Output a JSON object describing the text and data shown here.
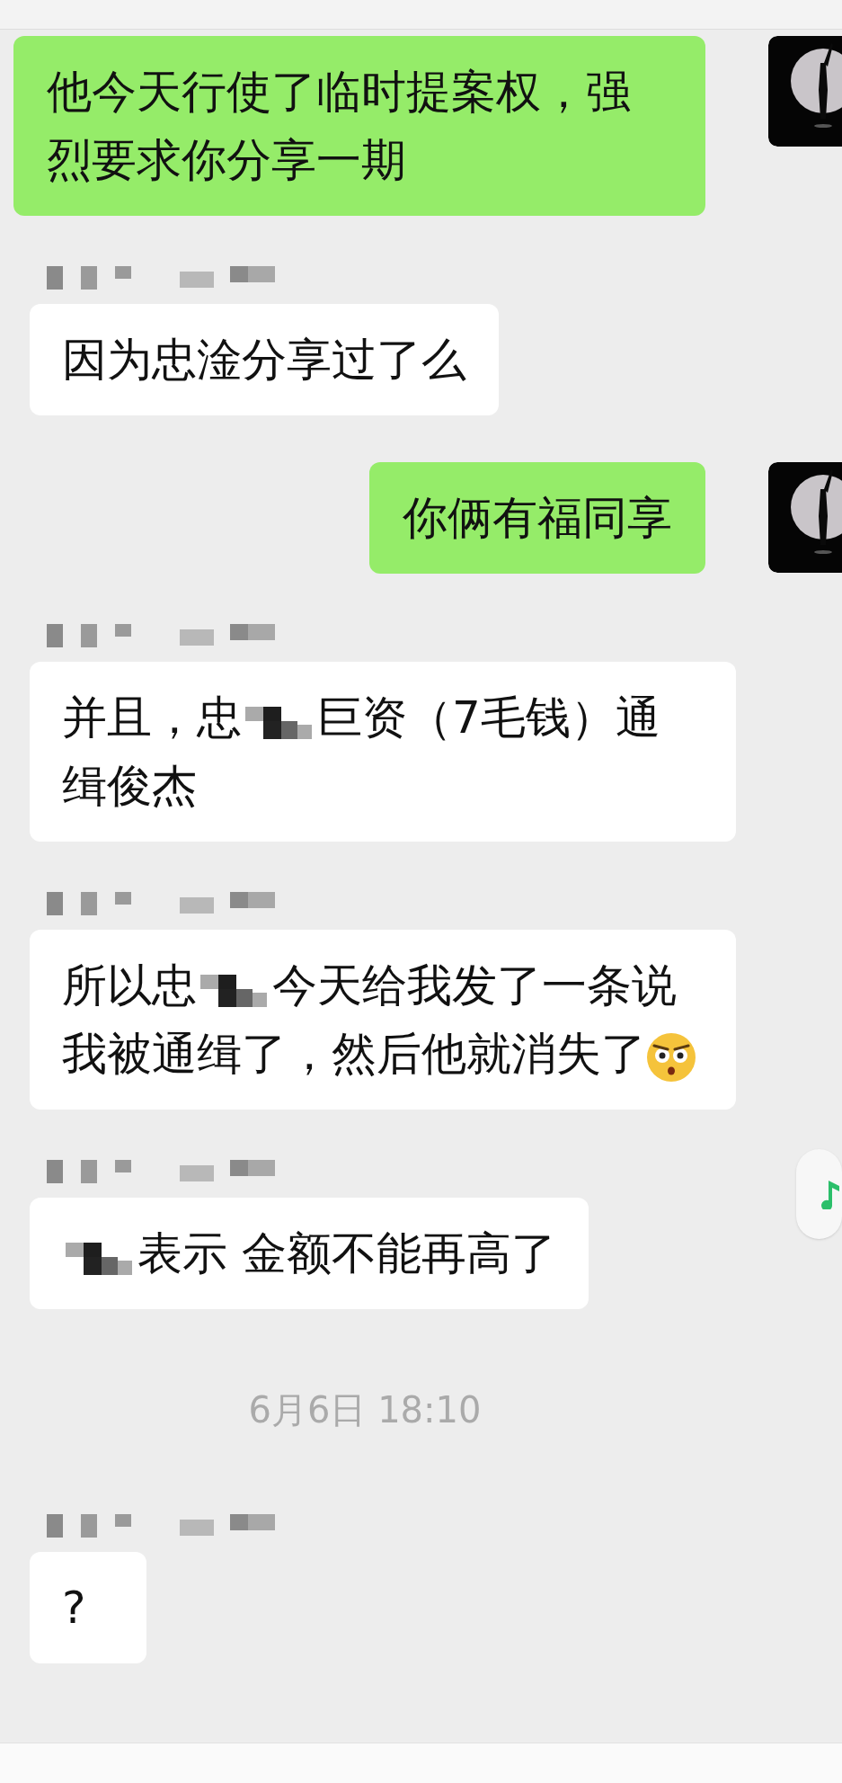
{
  "messages": [
    {
      "kind": "outgoing",
      "segments": [
        {
          "kind": "text",
          "text": "他今天行使了临时提案权，强烈要求你分享一期"
        }
      ]
    },
    {
      "kind": "incoming",
      "segments": [
        {
          "kind": "text",
          "text": "因为忠淦分享过了么"
        }
      ]
    },
    {
      "kind": "outgoing",
      "segments": [
        {
          "kind": "text",
          "text": "你俩有福同享"
        }
      ]
    },
    {
      "kind": "incoming",
      "segments": [
        {
          "kind": "text",
          "text": "并且，忠"
        },
        {
          "kind": "mosaic"
        },
        {
          "kind": "text",
          "text": "巨资（7毛钱）通缉俊杰"
        }
      ]
    },
    {
      "kind": "incoming",
      "segments": [
        {
          "kind": "text",
          "text": "所以忠"
        },
        {
          "kind": "mosaic"
        },
        {
          "kind": "text",
          "text": "今天给我发了一条说我被通缉了，然后他就消失了"
        },
        {
          "kind": "emoji"
        }
      ]
    },
    {
      "kind": "incoming",
      "segments": [
        {
          "kind": "mosaic"
        },
        {
          "kind": "text",
          "text": "表示 金额不能再高了"
        }
      ]
    },
    {
      "kind": "timestamp",
      "text": "6月6日 18:10"
    },
    {
      "kind": "incoming",
      "segments": [
        {
          "kind": "text",
          "text": "?"
        }
      ]
    }
  ]
}
